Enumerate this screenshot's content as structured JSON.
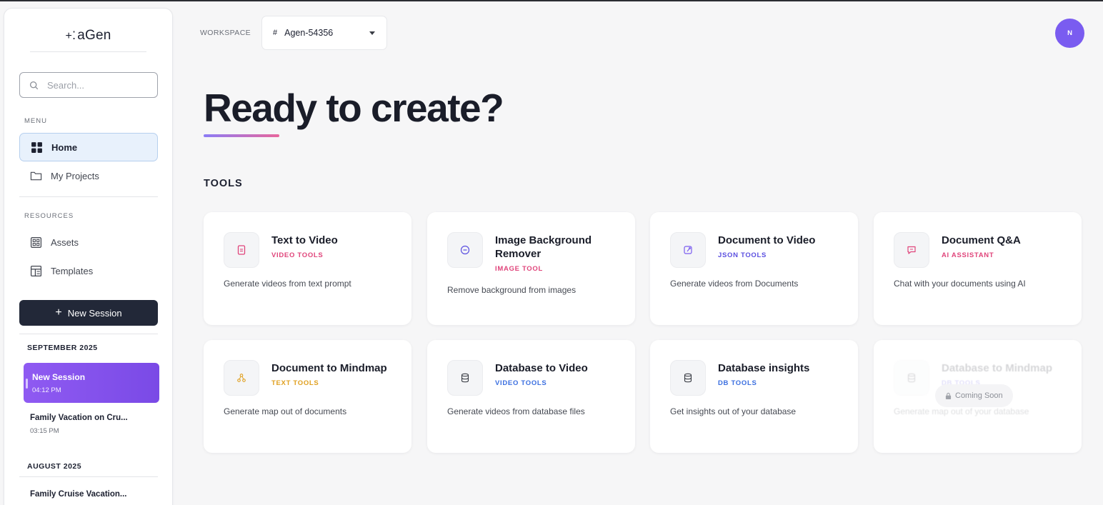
{
  "sidebar": {
    "logo": "aGen",
    "search_placeholder": "Search...",
    "menu_label": "MENU",
    "menu_items": [
      {
        "label": "Home",
        "icon": "grid-icon",
        "active": true
      },
      {
        "label": "My Projects",
        "icon": "folder-icon",
        "active": false
      }
    ],
    "resources_label": "RESOURCES",
    "resource_items": [
      {
        "label": "Assets",
        "icon": "assets-icon"
      },
      {
        "label": "Templates",
        "icon": "templates-icon"
      }
    ],
    "new_session_label": "New Session",
    "sessions": [
      {
        "month": "SEPTEMBER 2025",
        "items": [
          {
            "title": "New Session",
            "time": "04:12 PM",
            "active": true
          },
          {
            "title": "Family Vacation on Cru...",
            "time": "03:15 PM",
            "active": false
          }
        ]
      },
      {
        "month": "AUGUST 2025",
        "items": [
          {
            "title": "Family Cruise Vacation...",
            "time": "",
            "active": false
          }
        ]
      }
    ]
  },
  "header": {
    "workspace_label": "WORKSPACE",
    "workspace_hash": "#",
    "workspace_value": "Agen-54356",
    "avatar_initial": "N"
  },
  "main": {
    "title": "Ready to create?",
    "tools_label": "TOOLS",
    "tools": [
      {
        "title": "Text to Video",
        "category": "VIDEO TOOLS",
        "category_color": "#e0457b",
        "description": "Generate videos from text prompt",
        "icon": "document-icon"
      },
      {
        "title": "Image Background Remover",
        "category": "IMAGE TOOL",
        "category_color": "#e0457b",
        "description": "Remove background from images",
        "icon": "remove-circle-icon"
      },
      {
        "title": "Document to Video",
        "category": "JSON TOOLS",
        "category_color": "#5b4fe0",
        "description": "Generate videos from Documents",
        "icon": "doc-edit-icon"
      },
      {
        "title": "Document Q&A",
        "category": "AI ASSISTANT",
        "category_color": "#e0457b",
        "description": "Chat with your documents using AI",
        "icon": "chat-icon"
      },
      {
        "title": "Document to Mindmap",
        "category": "TEXT TOOLS",
        "category_color": "#e0a020",
        "description": "Generate map out of documents",
        "icon": "mindmap-icon"
      },
      {
        "title": "Database to Video",
        "category": "VIDEO TOOLS",
        "category_color": "#3b6fe0",
        "description": "Generate videos from database files",
        "icon": "database-icon"
      },
      {
        "title": "Database insights",
        "category": "DB TOOLS",
        "category_color": "#3b6fe0",
        "description": "Get insights out of your database",
        "icon": "database-icon"
      },
      {
        "title": "Database to Mindmap",
        "category": "DB TOOLS",
        "category_color": "#5b4fe0",
        "description": "Generate map out of your database",
        "icon": "database-icon",
        "disabled": true,
        "badge": "Coming Soon"
      }
    ]
  }
}
